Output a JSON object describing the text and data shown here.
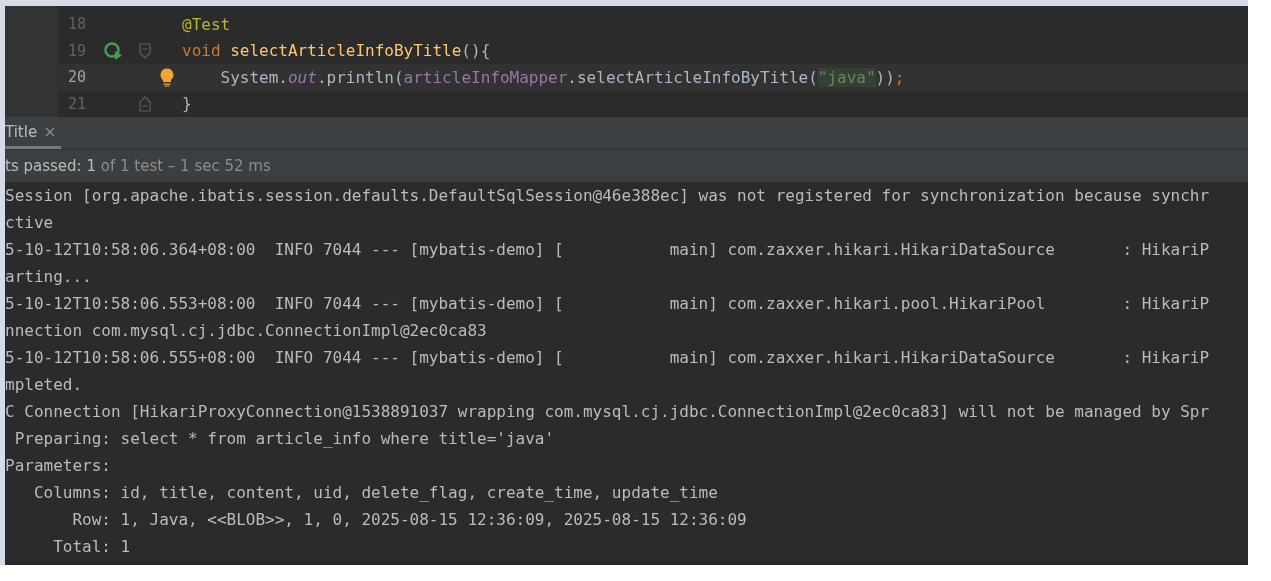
{
  "editor": {
    "lines": [
      {
        "number": "18",
        "current": false,
        "run_icon": false,
        "bulb": false,
        "fold_start": false,
        "fold_end": false,
        "tokens": [
          {
            "kind": "annotation",
            "text": "@Test"
          }
        ]
      },
      {
        "number": "19",
        "current": false,
        "run_icon": true,
        "bulb": false,
        "fold_start": true,
        "fold_end": false,
        "tokens": [
          {
            "kind": "keyword",
            "text": "void "
          },
          {
            "kind": "method",
            "text": "selectArticleInfoByTitle"
          },
          {
            "kind": "plain",
            "text": "(){"
          }
        ]
      },
      {
        "number": "20",
        "current": true,
        "run_icon": false,
        "bulb": true,
        "fold_start": false,
        "fold_end": false,
        "tokens": [
          {
            "kind": "plain",
            "text": "    System."
          },
          {
            "kind": "static",
            "text": "out"
          },
          {
            "kind": "plain",
            "text": ".println("
          },
          {
            "kind": "field",
            "text": "articleInfoMapper"
          },
          {
            "kind": "plain",
            "text": ".selectArticleInfoByTitle("
          },
          {
            "kind": "string",
            "text": "\"java\""
          },
          {
            "kind": "plain",
            "text": "))"
          },
          {
            "kind": "keyword",
            "text": ";"
          }
        ]
      },
      {
        "number": "21",
        "current": false,
        "run_icon": false,
        "bulb": false,
        "fold_start": false,
        "fold_end": true,
        "tokens": [
          {
            "kind": "plain",
            "text": "}"
          }
        ]
      }
    ]
  },
  "run_panel": {
    "tabs": [
      {
        "label": "Title",
        "selected": true
      }
    ],
    "status": {
      "label": "ts passed:",
      "count": "1",
      "detail": "of 1 test – 1 sec 52 ms"
    },
    "console": [
      "Session [org.apache.ibatis.session.defaults.DefaultSqlSession@46e388ec] was not registered for synchronization because synchr",
      "ctive",
      "5-10-12T10:58:06.364+08:00  INFO 7044 --- [mybatis-demo] [           main] com.zaxxer.hikari.HikariDataSource       : HikariP",
      "arting...",
      "5-10-12T10:58:06.553+08:00  INFO 7044 --- [mybatis-demo] [           main] com.zaxxer.hikari.pool.HikariPool        : HikariP",
      "nnection com.mysql.cj.jdbc.ConnectionImpl@2ec0ca83",
      "5-10-12T10:58:06.555+08:00  INFO 7044 --- [mybatis-demo] [           main] com.zaxxer.hikari.HikariDataSource       : HikariP",
      "mpleted.",
      "C Connection [HikariProxyConnection@1538891037 wrapping com.mysql.cj.jdbc.ConnectionImpl@2ec0ca83] will not be managed by Spr",
      " Preparing: select * from article_info where title='java'",
      "Parameters: ",
      "   Columns: id, title, content, uid, delete_flag, create_time, update_time",
      "       Row: 1, Java, <<BLOB>>, 1, 0, 2025-08-15 12:36:09, 2025-08-15 12:36:09",
      "     Total: 1"
    ]
  }
}
